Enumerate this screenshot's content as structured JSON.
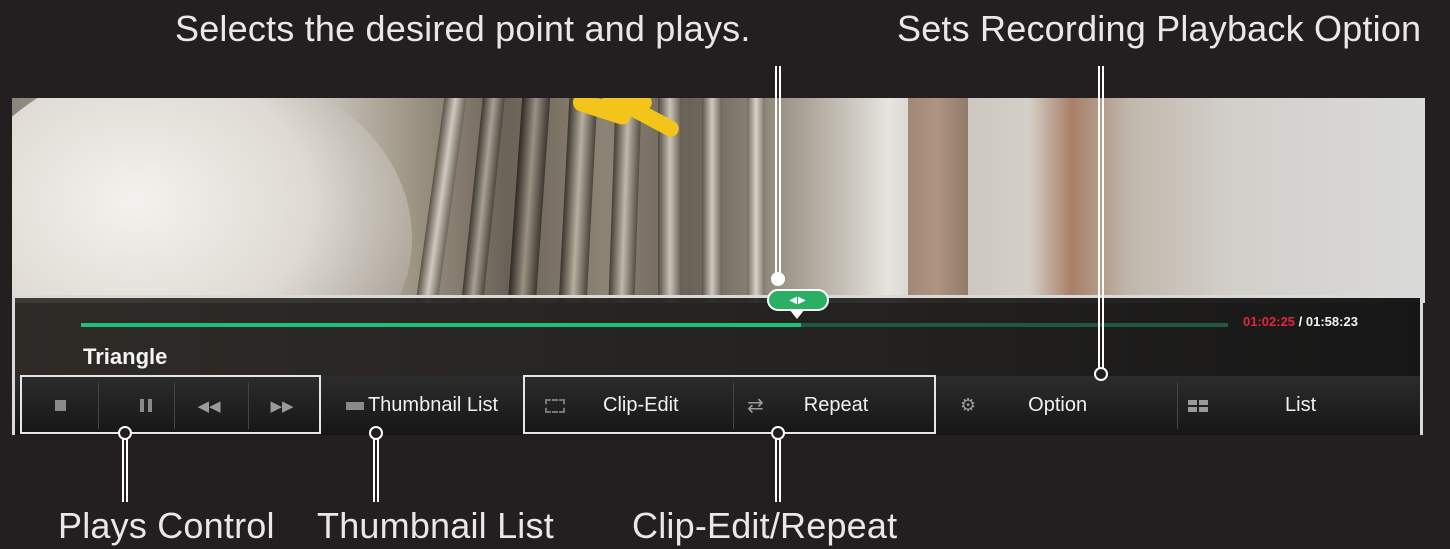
{
  "callouts": {
    "seek": "Selects the desired point and plays.",
    "option": "Sets Recording Playback Option",
    "plays_control": "Plays Control",
    "thumbnail_list": "Thumbnail List",
    "clip_edit_repeat": "Clip-Edit/Repeat"
  },
  "player": {
    "title": "Triangle",
    "time_current": "01:02:25",
    "time_separator": " / ",
    "time_total": "01:58:23",
    "progress": 0.628,
    "accent_color": "#19c27a",
    "current_time_color": "#e2263c"
  },
  "toolbar": {
    "stop_icon": "stop-icon",
    "pause_icon": "pause-icon",
    "rewind_icon": "rewind-icon",
    "fast_forward_icon": "fast-forward-icon",
    "thumbnail_list": "Thumbnail List",
    "clip_edit": "Clip-Edit",
    "repeat": "Repeat",
    "option": "Option",
    "list": "List"
  }
}
